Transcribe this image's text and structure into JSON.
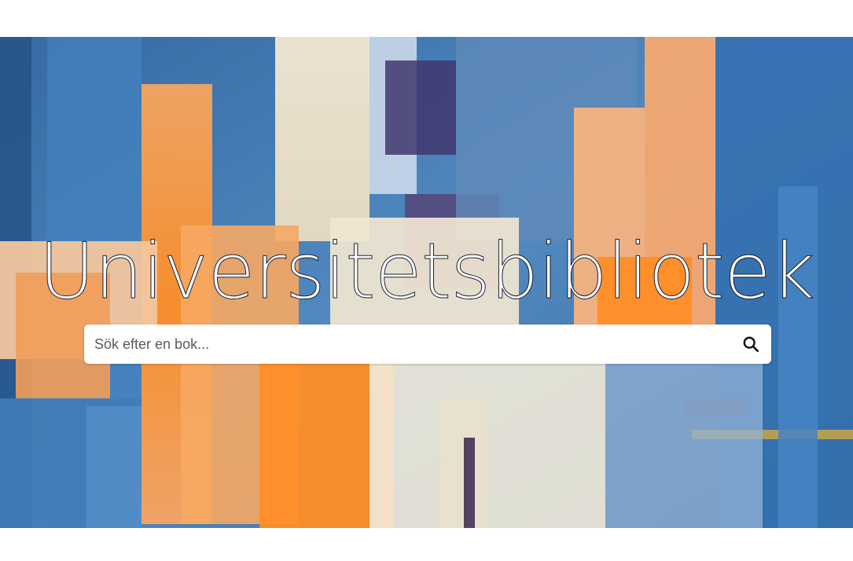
{
  "hero": {
    "title": "Universitetsbibliotek"
  },
  "search": {
    "placeholder": "Sök efter en bok...",
    "value": "",
    "icon": "search-icon"
  },
  "colors": {
    "background": "#ffffff",
    "title_fill": "#ffffff",
    "title_outline": "#1c2030"
  }
}
